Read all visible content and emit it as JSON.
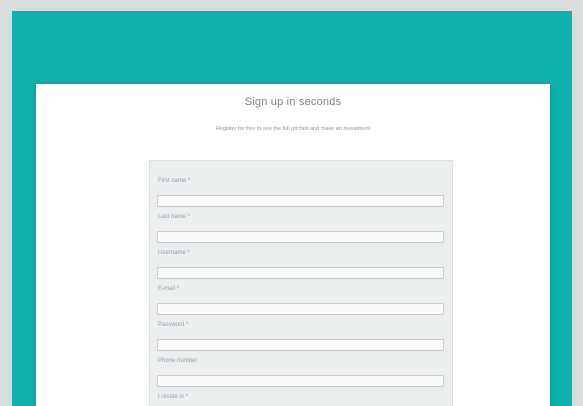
{
  "colors": {
    "background": "#d9dcdd",
    "banner": "#0fb1af",
    "card": "#ffffff",
    "form_panel": "#eaeeef",
    "input_background": "#fafafa"
  },
  "header": {
    "title": "Sign up in seconds",
    "subtitle": "Register for free to see the full pitches and make an investment"
  },
  "form": {
    "fields": [
      {
        "label": "First name *",
        "value": ""
      },
      {
        "label": "Last name *",
        "value": ""
      },
      {
        "label": "Username *",
        "value": ""
      },
      {
        "label": "E-mail *",
        "value": ""
      },
      {
        "label": "Password *",
        "value": ""
      },
      {
        "label": "Phone number",
        "value": ""
      },
      {
        "label": "I reside in *"
      }
    ]
  }
}
